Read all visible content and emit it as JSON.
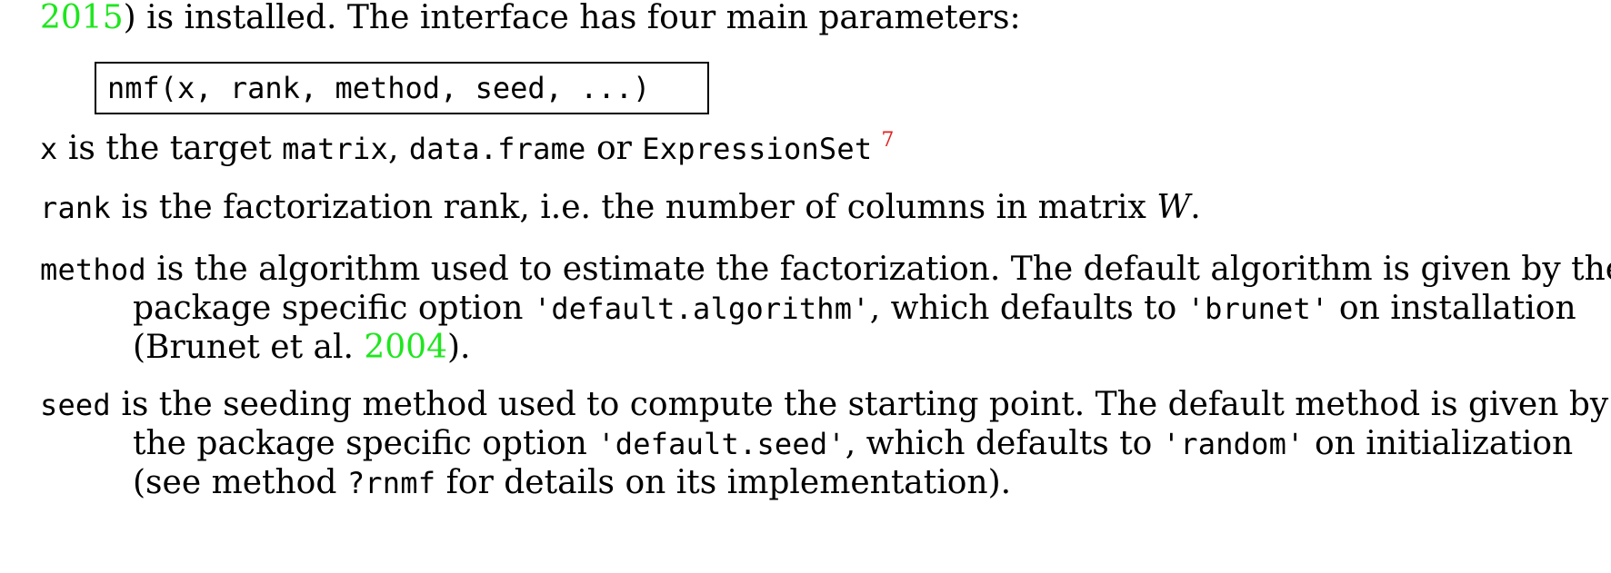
{
  "top_line": {
    "citation": "2015",
    "text": ") is installed. The interface has four main parameters:"
  },
  "code_signature": "nmf(x, rank, method, seed, ...)",
  "params": {
    "x": {
      "term": "x",
      "text_1": " is the target ",
      "type_1": "matrix",
      "text_2": ", ",
      "type_2": "data.frame",
      "text_3": " or ",
      "type_3": "ExpressionSet",
      "footnote": "7"
    },
    "rank": {
      "term": "rank",
      "text": " is the factorization rank, i.e. the number of columns in matrix ",
      "math": "W",
      "end": "."
    },
    "method": {
      "term": "method",
      "line1": " is the algorithm used to estimate the factorization. The default algorithm is given by the",
      "line2_a": "package specific option ",
      "option": "'default.algorithm'",
      "line2_b": ", which defaults to ",
      "default_value": "'brunet'",
      "line2_c": " on installation",
      "line3_a": "(Brunet et al. ",
      "citation": "2004",
      "line3_b": ")."
    },
    "seed": {
      "term": "seed",
      "line1": " is the seeding method used to compute the starting point. The default method is given by",
      "line2_a": "the package specific option ",
      "option": "'default.seed'",
      "line2_b": ", which defaults to ",
      "default_value": "'random'",
      "line2_c": " on initialization",
      "line3_a": "(see method ",
      "help_ref": "?rnmf",
      "line3_b": " for details on its implementation)."
    }
  },
  "colors": {
    "citation": "#1ee61e",
    "footnote": "#e12020",
    "text": "#000000"
  }
}
